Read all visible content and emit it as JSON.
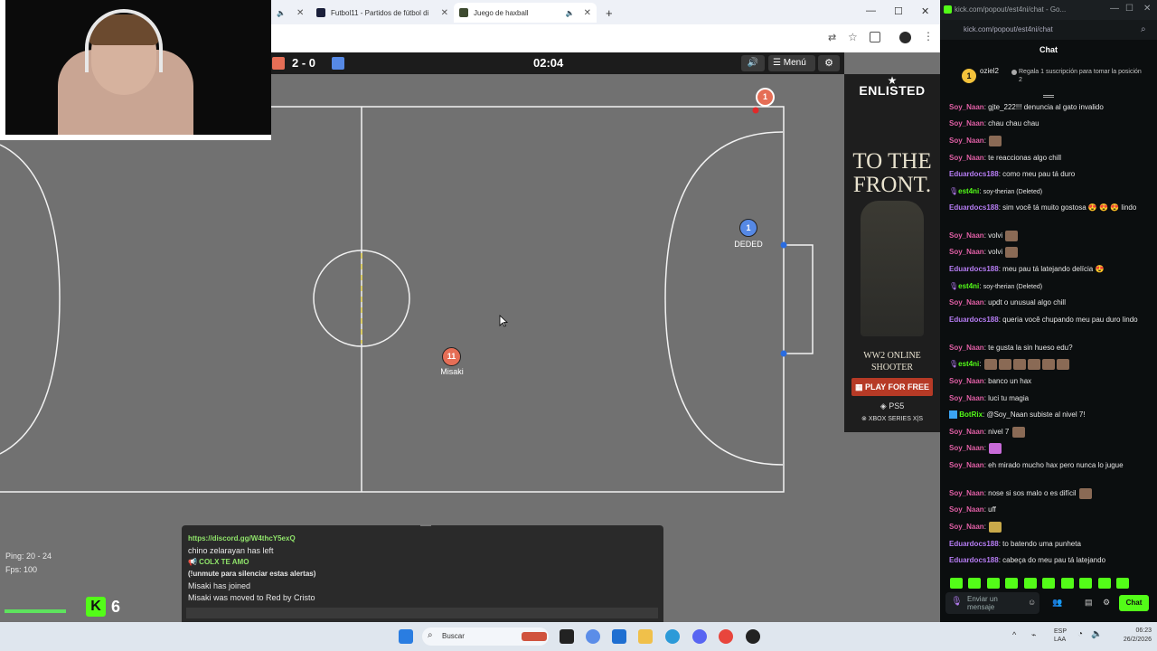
{
  "browser": {
    "tabs": [
      {
        "label": "Futbol11 - Partidos de fútbol di",
        "active": false
      },
      {
        "label": "Juego de haxball",
        "active": true
      }
    ],
    "new_tab": "+"
  },
  "game": {
    "score": {
      "red": 2,
      "sep": "-",
      "blue": 0,
      "text": "2 - 0"
    },
    "timer": "02:04",
    "menu_label": "Menú",
    "players": [
      {
        "number": "1",
        "name": "",
        "team": "red"
      },
      {
        "number": "1",
        "name": "DEDED",
        "team": "blue"
      },
      {
        "number": "11",
        "name": "Misaki",
        "team": "red"
      }
    ],
    "stats": {
      "ping": "Ping: 20 - 24",
      "fps": "Fps: 100"
    },
    "kick_count": "6",
    "chat_lines": [
      {
        "text": "https://discord.gg/W4thcY5exQ",
        "color": "#8fe36a",
        "bold": true
      },
      {
        "text": "chino zelarayan has left",
        "color": "#e6e6e6",
        "bold": false
      },
      {
        "text": "📢 COLX TE AMO",
        "color": "#8fe36a",
        "bold": true
      },
      {
        "text": "(!unmute para silenciar estas alertas)",
        "color": "#e6e6e6",
        "bold": true
      },
      {
        "text": "Misaki has joined",
        "color": "#e6e6e6",
        "bold": false
      },
      {
        "text": "Misaki was moved to Red by Cristo",
        "color": "#e6e6e6",
        "bold": false
      }
    ]
  },
  "ad": {
    "brand": "ENLISTED",
    "headline1": "TO THE",
    "headline2": "FRONT.",
    "sub1": "WW2 ONLINE",
    "sub2": "SHOOTER",
    "cta": "PLAY FOR FREE",
    "platform1": "PS5",
    "platform2": "XBOX SERIES X|S"
  },
  "kick": {
    "tab_url": "kick.com/popout/est4ni/chat - Go...",
    "address": "kick.com/popout/est4ni/chat",
    "title": "Chat",
    "pinned": {
      "user": "oziel2",
      "text": "Regala 1 suscripción para tomar la posición 2"
    },
    "messages": [
      {
        "user": "Soy_Naan",
        "color": "#e05fa5",
        "text": "gjte_222!!! denuncia al gato invalido"
      },
      {
        "user": "Soy_Naan",
        "color": "#e05fa5",
        "text": "chau chau chau"
      },
      {
        "user": "Soy_Naan",
        "color": "#e05fa5",
        "text": ""
      },
      {
        "user": "Soy_Naan",
        "color": "#e05fa5",
        "text": "te reaccionas algo chill"
      },
      {
        "user": "Eduardocs188",
        "color": "#b57cf2",
        "text": "como meu pau tá duro"
      },
      {
        "user": "est4ni",
        "color": "#53fc18",
        "text": "soy-therian (Deleted)"
      },
      {
        "user": "Eduardocs188",
        "color": "#b57cf2",
        "text": "sim você tá muito gostosa 😍 😍 😍 lindo"
      },
      {
        "user": "Soy_Naan",
        "color": "#e05fa5",
        "text": "volvi"
      },
      {
        "user": "Soy_Naan",
        "color": "#e05fa5",
        "text": "volvi"
      },
      {
        "user": "Eduardocs188",
        "color": "#b57cf2",
        "text": "meu pau tá latejando delícia 😍"
      },
      {
        "user": "est4ni",
        "color": "#53fc18",
        "text": "soy-therian (Deleted)"
      },
      {
        "user": "Soy_Naan",
        "color": "#e05fa5",
        "text": "updt o unusual algo chill"
      },
      {
        "user": "Eduardocs188",
        "color": "#b57cf2",
        "text": "queria você chupando meu pau duro lindo"
      },
      {
        "user": "Soy_Naan",
        "color": "#e05fa5",
        "text": "te gusta la sin hueso edu?"
      },
      {
        "user": "est4ni",
        "color": "#53fc18",
        "text": ""
      },
      {
        "user": "Soy_Naan",
        "color": "#e05fa5",
        "text": "banco un hax"
      },
      {
        "user": "Soy_Naan",
        "color": "#e05fa5",
        "text": "luci tu magia"
      },
      {
        "user": "BotRix",
        "color": "#53fc18",
        "text": "@Soy_Naan subiste al nivel 7!"
      },
      {
        "user": "Soy_Naan",
        "color": "#e05fa5",
        "text": "nivel 7"
      },
      {
        "user": "Soy_Naan",
        "color": "#e05fa5",
        "text": ""
      },
      {
        "user": "Soy_Naan",
        "color": "#e05fa5",
        "text": "eh mirado mucho hax pero nunca lo jugue"
      },
      {
        "user": "Soy_Naan",
        "color": "#e05fa5",
        "text": "nose si sos malo o es difícil"
      },
      {
        "user": "Soy_Naan",
        "color": "#e05fa5",
        "text": "uff"
      },
      {
        "user": "Soy_Naan",
        "color": "#e05fa5",
        "text": ""
      },
      {
        "user": "Eduardocs188",
        "color": "#b57cf2",
        "text": "to batendo uma punheta"
      },
      {
        "user": "Eduardocs188",
        "color": "#b57cf2",
        "text": "cabeça do meu pau tá latejando"
      }
    ],
    "input_placeholder": "Enviar un mensaje",
    "send_label": "Chat"
  },
  "taskbar": {
    "search_label": "Buscar",
    "lang1": "ESP",
    "lang2": "LAA",
    "time": "06:23",
    "date": "26/2/2026"
  },
  "colors": {
    "red_team": "#e56e56",
    "blue_team": "#5689e5",
    "kick_green": "#53fc18",
    "field": "#717171"
  }
}
